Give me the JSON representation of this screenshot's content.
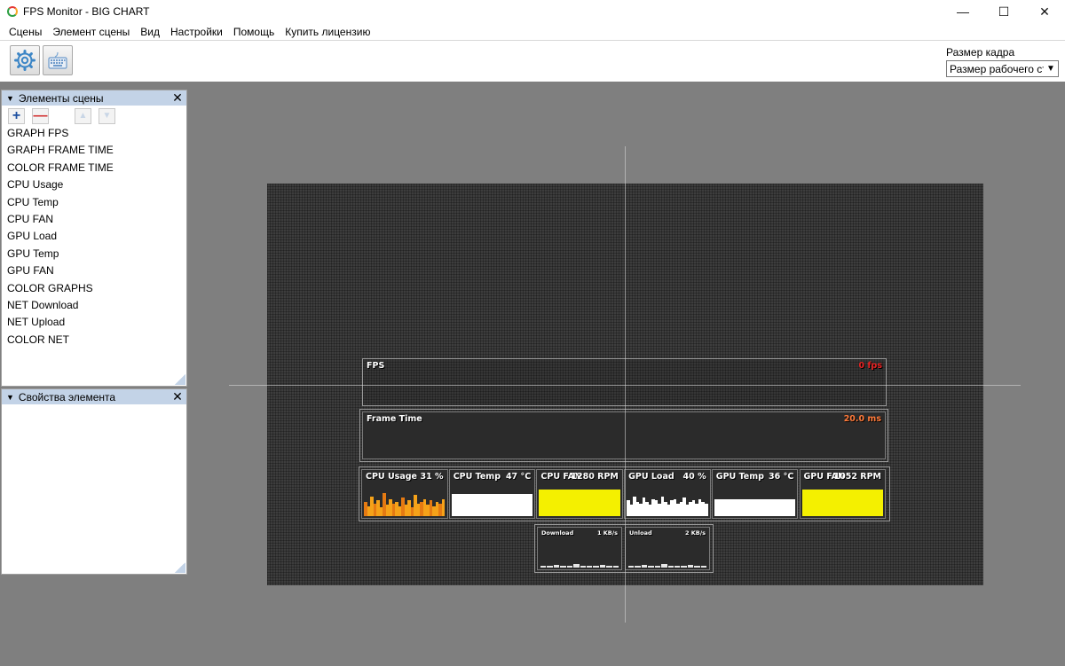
{
  "window": {
    "title": "FPS Monitor - BIG CHART",
    "controls": {
      "minimize": "—",
      "maximize": "☐",
      "close": "✕"
    }
  },
  "menu": [
    "Сцены",
    "Элемент сцены",
    "Вид",
    "Настройки",
    "Помощь",
    "Купить лицензию"
  ],
  "toolbar": {
    "buttons": [
      {
        "icon": "gear-icon"
      },
      {
        "icon": "keyboard-icon"
      }
    ],
    "frame_size_label": "Размер кадра",
    "frame_size_value": "Размер рабочего стола"
  },
  "scene_panel": {
    "title": "Элементы сцены",
    "tools": {
      "add": "+",
      "remove": "—",
      "up": "▲",
      "down": "▼"
    },
    "items": [
      "GRAPH FPS",
      "GRAPH FRAME TIME",
      "COLOR FRAME TIME",
      "CPU Usage",
      "CPU Temp",
      "CPU FAN",
      "GPU Load",
      "GPU Temp",
      "GPU FAN",
      "COLOR GRAPHS",
      "NET Download",
      "NET Upload",
      "COLOR NET"
    ]
  },
  "properties_panel": {
    "title": "Свойства элемента"
  },
  "overlay": {
    "fps": {
      "label": "FPS",
      "value": "0 fps",
      "value_color": "#e52222"
    },
    "frame_time": {
      "label": "Frame Time",
      "value": "20.0 ms",
      "value_color": "#ff7a3a"
    },
    "sensors": [
      {
        "label": "CPU Usage",
        "value": "31 %",
        "color": "#f5a219",
        "level": 0.31
      },
      {
        "label": "CPU Temp",
        "value": "47 °C",
        "color": "#ffffff",
        "level": 0.78
      },
      {
        "label": "CPU FAN",
        "value": "1280 RPM",
        "color": "#f4f000",
        "level": 0.95
      },
      {
        "label": "GPU Load",
        "value": "40 %",
        "color": "#ffffff",
        "level": 0.4
      },
      {
        "label": "GPU Temp",
        "value": "36 °C",
        "color": "#ffffff",
        "level": 0.6
      },
      {
        "label": "GPU FAN",
        "value": "1052 RPM",
        "color": "#f4f000",
        "level": 0.95
      }
    ],
    "net": [
      {
        "label": "Download",
        "value": "1 KB/s"
      },
      {
        "label": "Unload",
        "value": "2 KB/s"
      }
    ]
  }
}
